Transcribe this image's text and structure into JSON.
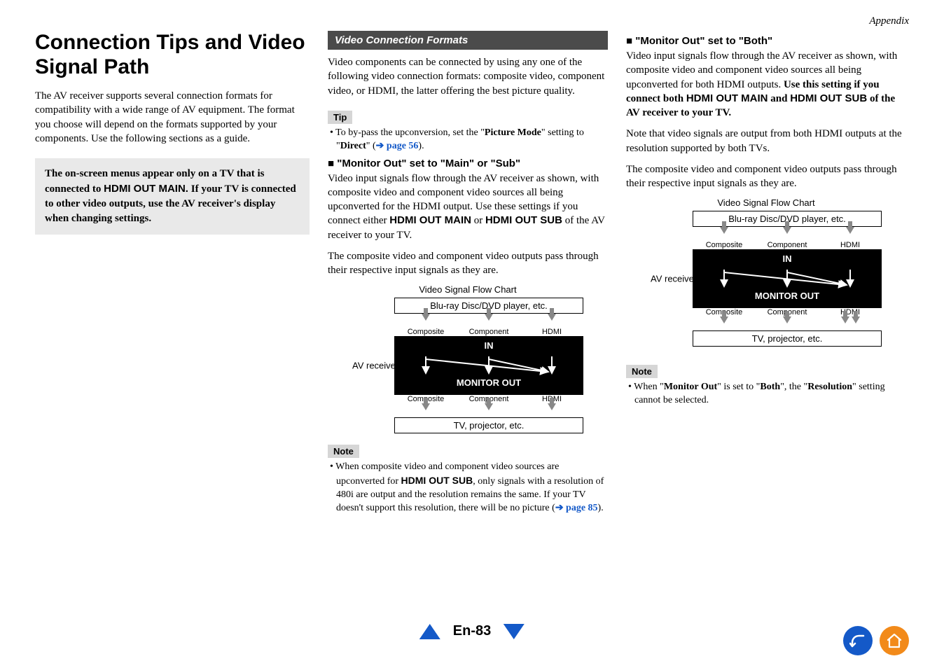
{
  "header": {
    "appendix": "Appendix"
  },
  "col1": {
    "title": "Connection Tips and Video Signal Path",
    "intro": "The AV receiver supports several connection formats for compatibility with a wide range of AV equipment. The format you choose will depend on the formats supported by your components. Use the following sections as a guide.",
    "callout_pre": "The on-screen menus appear only on a TV that is connected to ",
    "callout_bold1": "HDMI OUT MAIN.",
    "callout_post": " If your TV is connected to other video outputs, use the AV receiver's display when changing settings."
  },
  "col2": {
    "section_title": "Video Connection Formats",
    "p1": "Video components can be connected by using any one of the following video connection formats: composite video, component video, or HDMI, the latter offering the best picture quality.",
    "tip_label": "Tip",
    "tip_pre": "To by-pass the upconversion, set the \"",
    "tip_bold": "Picture Mode",
    "tip_mid": "\" setting to \"",
    "tip_bold2": "Direct",
    "tip_post": "\" (",
    "tip_link": "page 56",
    "tip_close": ").",
    "sub1": "\"Monitor Out\" set to \"Main\" or \"Sub\"",
    "sub1_p_a": "Video input signals flow through the AV receiver as shown, with composite video and component video sources all being upconverted for the HDMI output. Use these settings if you connect either ",
    "sub1_bold1": "HDMI OUT MAIN",
    "sub1_mid": " or ",
    "sub1_bold2": "HDMI OUT SUB",
    "sub1_end": " of the AV receiver to your TV.",
    "sub1_p2": "The composite video and component video outputs pass through their respective input signals as they are.",
    "chart_title": "Video Signal Flow Chart",
    "note_label": "Note",
    "note_pre": "When composite video and component video sources are upconverted for ",
    "note_bold": "HDMI OUT SUB",
    "note_post": ", only signals with a resolution of 480i are output and the resolution remains the same. If your TV doesn't support this resolution, there will be no picture (",
    "note_link": "page 85",
    "note_close": ")."
  },
  "col3": {
    "sub1": "\"Monitor Out\" set to \"Both\"",
    "p1_a": "Video input signals flow through the AV receiver as shown, with composite video and component video sources all being upconverted for both HDMI outputs. ",
    "p1_bold_a": "Use this setting if you connect both ",
    "p1_bold_sans1": "HDMI OUT MAIN",
    "p1_bold_mid": " and ",
    "p1_bold_sans2": "HDMI OUT SUB",
    "p1_bold_b": " of the AV receiver to your TV.",
    "p2": "Note that video signals are output from both HDMI outputs at the resolution supported by both TVs.",
    "p3": "The composite video and component video outputs pass through their respective input signals as they are.",
    "chart_title": "Video Signal Flow Chart",
    "note_label": "Note",
    "note_pre": "When \"",
    "note_b1": "Monitor Out",
    "note_mid1": "\" is set to \"",
    "note_b2": "Both",
    "note_mid2": "\", the \"",
    "note_b3": "Resolution",
    "note_post": "\" setting cannot be selected."
  },
  "flowchart": {
    "source": "Blu-ray Disc/DVD player, etc.",
    "sig1": "Composite",
    "sig2": "Component",
    "sig3": "HDMI",
    "in": "IN",
    "out": "MONITOR OUT",
    "av": "AV receiver",
    "dest": "TV, projector, etc."
  },
  "footer": {
    "page": "En-83"
  }
}
